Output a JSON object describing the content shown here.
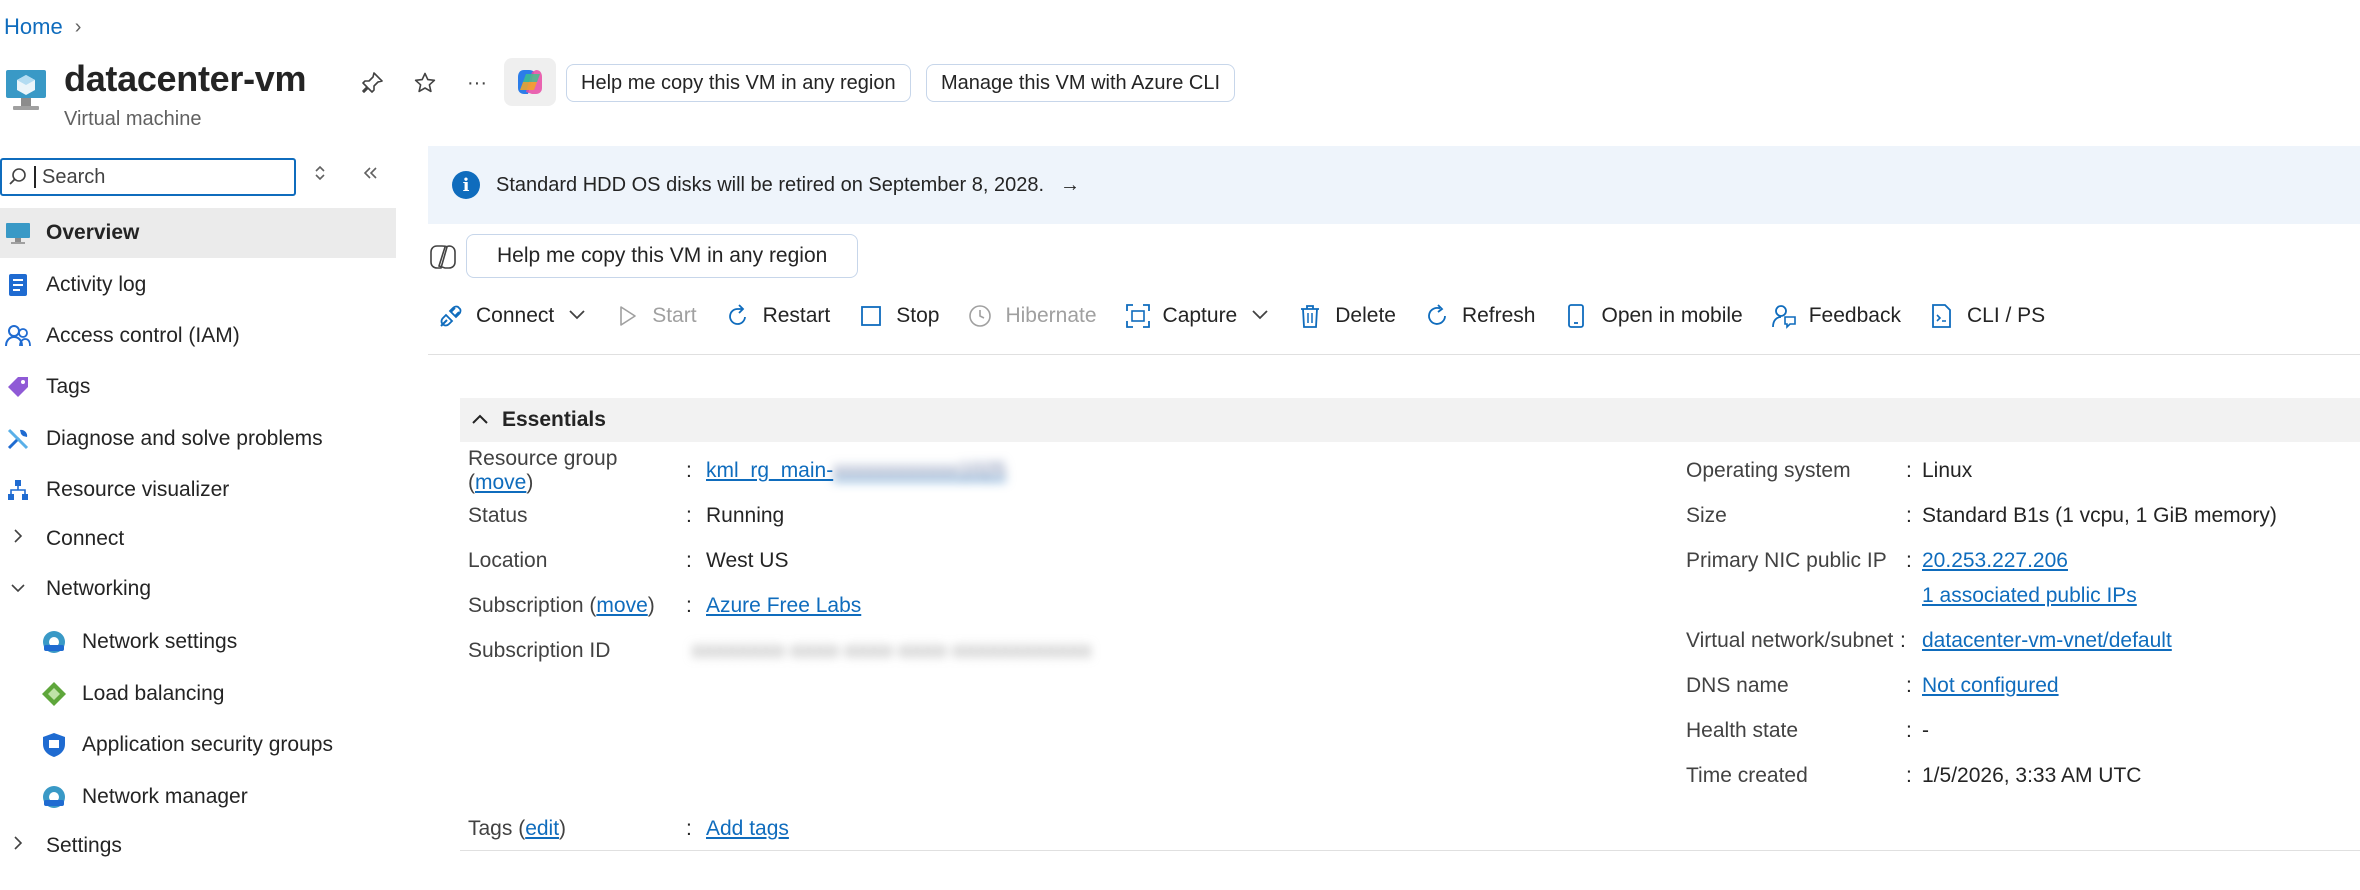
{
  "breadcrumb": {
    "home": "Home",
    "chevron": "›"
  },
  "header": {
    "title": "datacenter-vm",
    "subtitle": "Virtual machine",
    "more": "···",
    "pill_copy": "Help me copy this VM in any region",
    "pill_cli": "Manage this VM with Azure CLI"
  },
  "sidebar": {
    "search_placeholder": "Search",
    "items": [
      {
        "label": "Overview"
      },
      {
        "label": "Activity log"
      },
      {
        "label": "Access control (IAM)"
      },
      {
        "label": "Tags"
      },
      {
        "label": "Diagnose and solve problems"
      },
      {
        "label": "Resource visualizer"
      },
      {
        "label": "Connect"
      },
      {
        "label": "Networking"
      },
      {
        "label": "Network settings"
      },
      {
        "label": "Load balancing"
      },
      {
        "label": "Application security groups"
      },
      {
        "label": "Network manager"
      },
      {
        "label": "Settings"
      }
    ]
  },
  "banner": {
    "text": "Standard HDD OS disks will be retired on September 8, 2028.",
    "arrow": "→"
  },
  "copilot_pill": "Help me copy this VM in any region",
  "toolbar": {
    "connect": "Connect",
    "start": "Start",
    "restart": "Restart",
    "stop": "Stop",
    "hibernate": "Hibernate",
    "capture": "Capture",
    "delete": "Delete",
    "refresh": "Refresh",
    "open_mobile": "Open in mobile",
    "feedback": "Feedback",
    "cli": "CLI / PS"
  },
  "essentials": {
    "title": "Essentials",
    "left": {
      "rg_label": "Resource group (",
      "rg_move": "move",
      "rg_close": ")",
      "rg_value": "kml_rg_main-",
      "rg_value_hidden": "xxxxxxxxxxxx1025",
      "status_label": "Status",
      "status_value": "Running",
      "location_label": "Location",
      "location_value": "West US",
      "sub_label": "Subscription (",
      "sub_move": "move",
      "sub_close": ")",
      "sub_value": "Azure Free Labs",
      "subid_label": "Subscription ID",
      "subid_value_hidden": "xxxxxxxx-xxxx-xxxx-xxxx-xxxxxxxxxxxx",
      "tags_label": "Tags (",
      "tags_edit": "edit",
      "tags_close": ")",
      "tags_value": "Add tags"
    },
    "right": {
      "os_label": "Operating system",
      "os_value": "Linux",
      "size_label": "Size",
      "size_value": "Standard B1s (1 vcpu, 1 GiB memory)",
      "ip_label": "Primary NIC public IP",
      "ip_value": "20.253.227.206",
      "ip_assoc": "1 associated public IPs",
      "vnet_label": "Virtual network/subnet",
      "vnet_value": "datacenter-vm-vnet/default",
      "dns_label": "DNS name",
      "dns_value": "Not configured",
      "health_label": "Health state",
      "health_value": "-",
      "time_label": "Time created",
      "time_value": "1/5/2026, 3:33 AM UTC"
    },
    "colon": ":"
  }
}
